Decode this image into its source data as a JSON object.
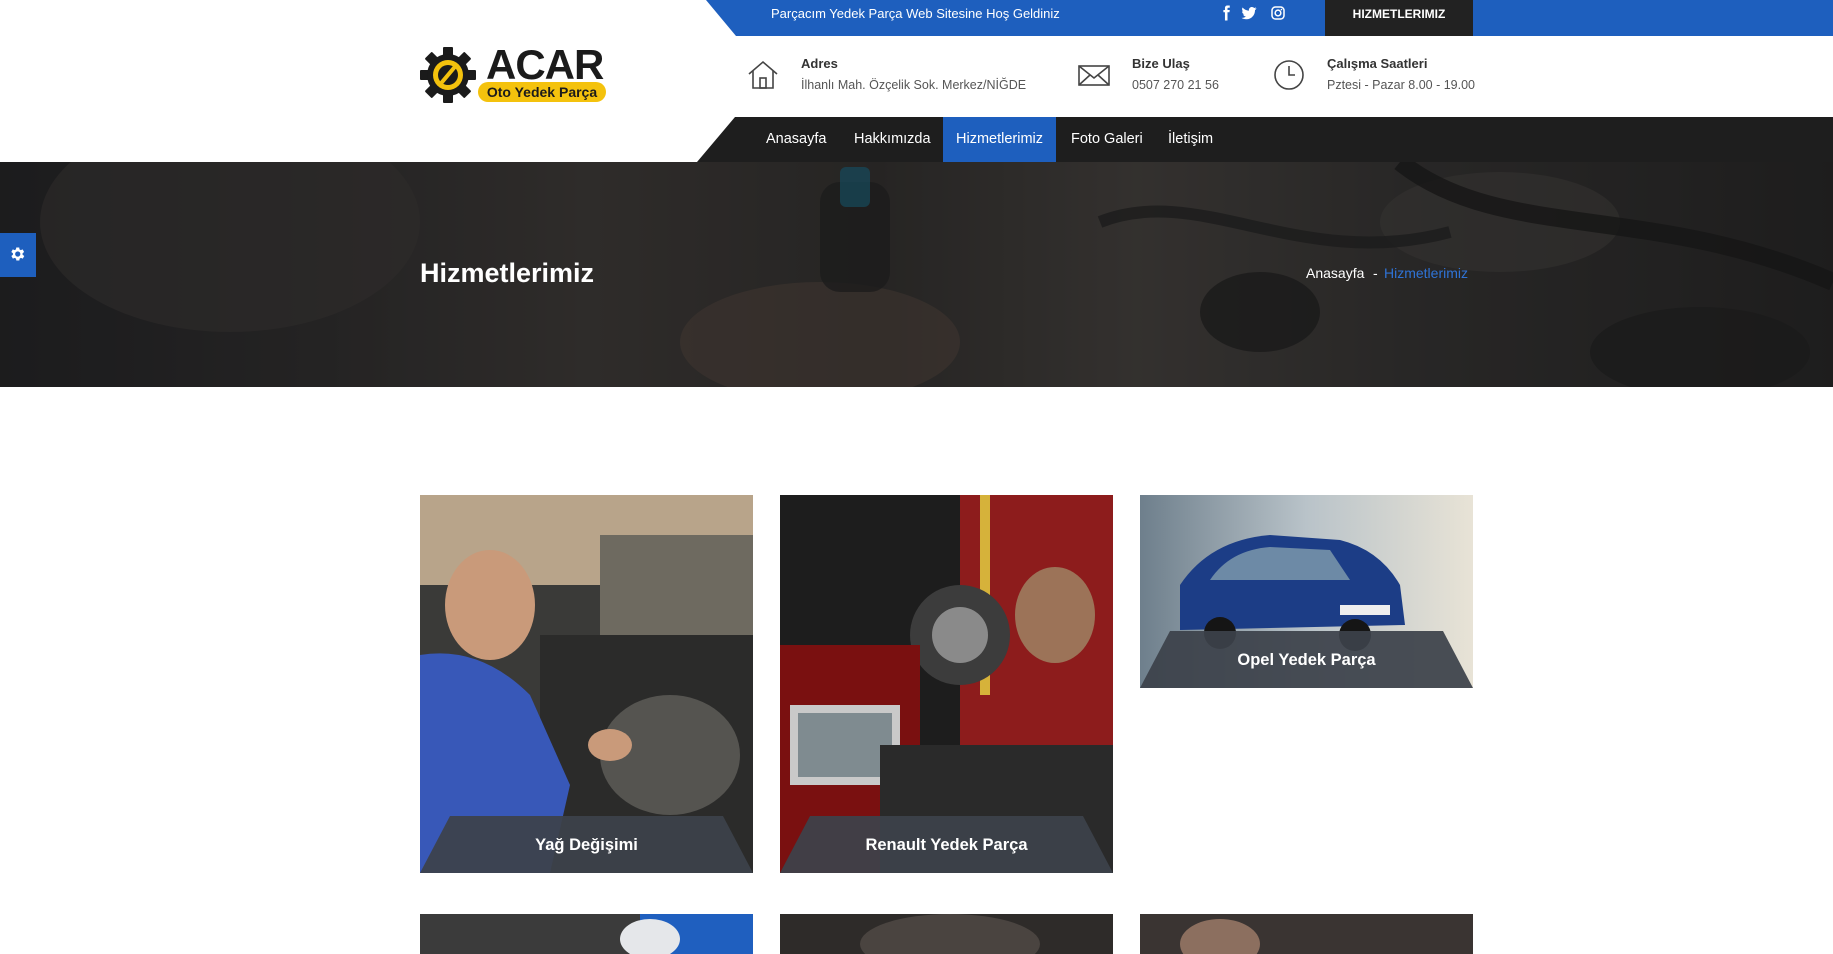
{
  "topbar": {
    "welcome": "Parçacım Yedek Parça Web Sitesine Hoş Geldiniz",
    "social_icons": [
      "facebook-icon",
      "twitter-icon",
      "instagram-icon"
    ],
    "cta": "HIZMETLERIMIZ"
  },
  "logo": {
    "main": "ACAR",
    "sub": "Oto Yedek Parça"
  },
  "info": [
    {
      "icon": "home-icon",
      "label": "Adres",
      "value": "İlhanlı Mah. Özçelik Sok. Merkez/NİĞDE"
    },
    {
      "icon": "mail-icon",
      "label": "Bize Ulaş",
      "value": "0507 270 21 56"
    },
    {
      "icon": "clock-icon",
      "label": "Çalışma Saatleri",
      "value": "Pztesi - Pazar 8.00 - 19.00"
    }
  ],
  "nav": {
    "items": [
      "Anasayfa",
      "Hakkımızda",
      "Hizmetlerimiz",
      "Foto Galeri",
      "İletişim"
    ],
    "active": "Hizmetlerimiz"
  },
  "hero": {
    "title": "Hizmetlerimiz",
    "breadcrumb": {
      "home": "Anasayfa",
      "separator": "-",
      "current": "Hizmetlerimiz"
    }
  },
  "services": [
    {
      "label": "Yağ Değişimi"
    },
    {
      "label": "Renault Yedek Parça"
    },
    {
      "label": "Opel Yedek Parça"
    }
  ],
  "colors": {
    "primary": "#1e5fbe",
    "dark": "#1e1e1e",
    "logo_yellow": "#f4c20d"
  }
}
